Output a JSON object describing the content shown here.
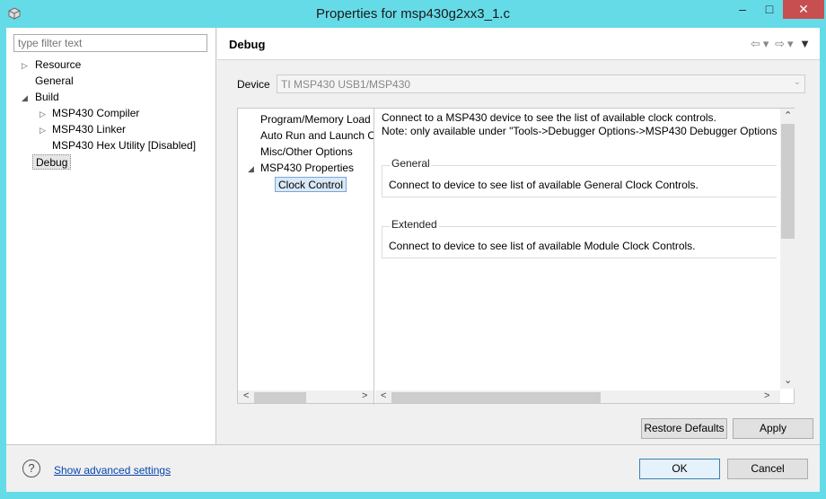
{
  "window": {
    "title": "Properties for msp430g2xx3_1.c",
    "min": "–",
    "max": "□",
    "close": "✕"
  },
  "left": {
    "filter_placeholder": "type filter text",
    "tree": [
      {
        "label": "Resource",
        "indent": 1,
        "toggle": "▷"
      },
      {
        "label": "General",
        "indent": 1,
        "toggle": ""
      },
      {
        "label": "Build",
        "indent": 1,
        "toggle": "◢"
      },
      {
        "label": "MSP430 Compiler",
        "indent": 2,
        "toggle": "▷"
      },
      {
        "label": "MSP430 Linker",
        "indent": 2,
        "toggle": "▷"
      },
      {
        "label": "MSP430 Hex Utility  [Disabled]",
        "indent": 2,
        "toggle": ""
      },
      {
        "label": "Debug",
        "indent": 1,
        "toggle": "",
        "selected": true
      }
    ]
  },
  "right": {
    "title": "Debug",
    "device_label": "Device",
    "device_value": "TI MSP430 USB1/MSP430",
    "inner_tree": [
      {
        "label": "Program/Memory Load"
      },
      {
        "label": "Auto Run and Launch O"
      },
      {
        "label": "Misc/Other Options"
      },
      {
        "label": "MSP430 Properties",
        "toggle": "◢"
      },
      {
        "label": "Clock Control",
        "selected": true
      }
    ],
    "message_line1": "Connect to a MSP430 device to see the list of available clock controls.",
    "message_line2": "Note: only available under \"Tools->Debugger Options->MSP430 Debugger Options",
    "groups": [
      {
        "title": "General",
        "text": "Connect to device to see list of available General Clock Controls."
      },
      {
        "title": "Extended",
        "text": "Connect to device to see list of available Module Clock Controls."
      }
    ],
    "restore_defaults_label": "Restore Defaults",
    "apply_label": "Apply"
  },
  "footer": {
    "help_symbol": "?",
    "advanced_link": "Show advanced settings",
    "ok_label": "OK",
    "cancel_label": "Cancel"
  }
}
